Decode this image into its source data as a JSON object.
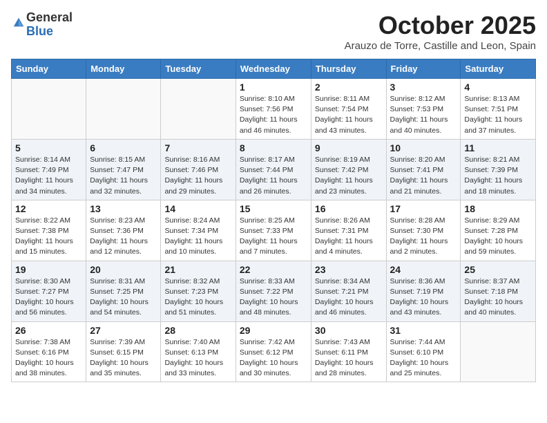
{
  "header": {
    "logo_general": "General",
    "logo_blue": "Blue",
    "month_title": "October 2025",
    "subtitle": "Arauzo de Torre, Castille and Leon, Spain"
  },
  "days_of_week": [
    "Sunday",
    "Monday",
    "Tuesday",
    "Wednesday",
    "Thursday",
    "Friday",
    "Saturday"
  ],
  "weeks": [
    [
      {
        "day": "",
        "sunrise": "",
        "sunset": "",
        "daylight": ""
      },
      {
        "day": "",
        "sunrise": "",
        "sunset": "",
        "daylight": ""
      },
      {
        "day": "",
        "sunrise": "",
        "sunset": "",
        "daylight": ""
      },
      {
        "day": "1",
        "sunrise": "Sunrise: 8:10 AM",
        "sunset": "Sunset: 7:56 PM",
        "daylight": "Daylight: 11 hours and 46 minutes."
      },
      {
        "day": "2",
        "sunrise": "Sunrise: 8:11 AM",
        "sunset": "Sunset: 7:54 PM",
        "daylight": "Daylight: 11 hours and 43 minutes."
      },
      {
        "day": "3",
        "sunrise": "Sunrise: 8:12 AM",
        "sunset": "Sunset: 7:53 PM",
        "daylight": "Daylight: 11 hours and 40 minutes."
      },
      {
        "day": "4",
        "sunrise": "Sunrise: 8:13 AM",
        "sunset": "Sunset: 7:51 PM",
        "daylight": "Daylight: 11 hours and 37 minutes."
      }
    ],
    [
      {
        "day": "5",
        "sunrise": "Sunrise: 8:14 AM",
        "sunset": "Sunset: 7:49 PM",
        "daylight": "Daylight: 11 hours and 34 minutes."
      },
      {
        "day": "6",
        "sunrise": "Sunrise: 8:15 AM",
        "sunset": "Sunset: 7:47 PM",
        "daylight": "Daylight: 11 hours and 32 minutes."
      },
      {
        "day": "7",
        "sunrise": "Sunrise: 8:16 AM",
        "sunset": "Sunset: 7:46 PM",
        "daylight": "Daylight: 11 hours and 29 minutes."
      },
      {
        "day": "8",
        "sunrise": "Sunrise: 8:17 AM",
        "sunset": "Sunset: 7:44 PM",
        "daylight": "Daylight: 11 hours and 26 minutes."
      },
      {
        "day": "9",
        "sunrise": "Sunrise: 8:19 AM",
        "sunset": "Sunset: 7:42 PM",
        "daylight": "Daylight: 11 hours and 23 minutes."
      },
      {
        "day": "10",
        "sunrise": "Sunrise: 8:20 AM",
        "sunset": "Sunset: 7:41 PM",
        "daylight": "Daylight: 11 hours and 21 minutes."
      },
      {
        "day": "11",
        "sunrise": "Sunrise: 8:21 AM",
        "sunset": "Sunset: 7:39 PM",
        "daylight": "Daylight: 11 hours and 18 minutes."
      }
    ],
    [
      {
        "day": "12",
        "sunrise": "Sunrise: 8:22 AM",
        "sunset": "Sunset: 7:38 PM",
        "daylight": "Daylight: 11 hours and 15 minutes."
      },
      {
        "day": "13",
        "sunrise": "Sunrise: 8:23 AM",
        "sunset": "Sunset: 7:36 PM",
        "daylight": "Daylight: 11 hours and 12 minutes."
      },
      {
        "day": "14",
        "sunrise": "Sunrise: 8:24 AM",
        "sunset": "Sunset: 7:34 PM",
        "daylight": "Daylight: 11 hours and 10 minutes."
      },
      {
        "day": "15",
        "sunrise": "Sunrise: 8:25 AM",
        "sunset": "Sunset: 7:33 PM",
        "daylight": "Daylight: 11 hours and 7 minutes."
      },
      {
        "day": "16",
        "sunrise": "Sunrise: 8:26 AM",
        "sunset": "Sunset: 7:31 PM",
        "daylight": "Daylight: 11 hours and 4 minutes."
      },
      {
        "day": "17",
        "sunrise": "Sunrise: 8:28 AM",
        "sunset": "Sunset: 7:30 PM",
        "daylight": "Daylight: 11 hours and 2 minutes."
      },
      {
        "day": "18",
        "sunrise": "Sunrise: 8:29 AM",
        "sunset": "Sunset: 7:28 PM",
        "daylight": "Daylight: 10 hours and 59 minutes."
      }
    ],
    [
      {
        "day": "19",
        "sunrise": "Sunrise: 8:30 AM",
        "sunset": "Sunset: 7:27 PM",
        "daylight": "Daylight: 10 hours and 56 minutes."
      },
      {
        "day": "20",
        "sunrise": "Sunrise: 8:31 AM",
        "sunset": "Sunset: 7:25 PM",
        "daylight": "Daylight: 10 hours and 54 minutes."
      },
      {
        "day": "21",
        "sunrise": "Sunrise: 8:32 AM",
        "sunset": "Sunset: 7:23 PM",
        "daylight": "Daylight: 10 hours and 51 minutes."
      },
      {
        "day": "22",
        "sunrise": "Sunrise: 8:33 AM",
        "sunset": "Sunset: 7:22 PM",
        "daylight": "Daylight: 10 hours and 48 minutes."
      },
      {
        "day": "23",
        "sunrise": "Sunrise: 8:34 AM",
        "sunset": "Sunset: 7:21 PM",
        "daylight": "Daylight: 10 hours and 46 minutes."
      },
      {
        "day": "24",
        "sunrise": "Sunrise: 8:36 AM",
        "sunset": "Sunset: 7:19 PM",
        "daylight": "Daylight: 10 hours and 43 minutes."
      },
      {
        "day": "25",
        "sunrise": "Sunrise: 8:37 AM",
        "sunset": "Sunset: 7:18 PM",
        "daylight": "Daylight: 10 hours and 40 minutes."
      }
    ],
    [
      {
        "day": "26",
        "sunrise": "Sunrise: 7:38 AM",
        "sunset": "Sunset: 6:16 PM",
        "daylight": "Daylight: 10 hours and 38 minutes."
      },
      {
        "day": "27",
        "sunrise": "Sunrise: 7:39 AM",
        "sunset": "Sunset: 6:15 PM",
        "daylight": "Daylight: 10 hours and 35 minutes."
      },
      {
        "day": "28",
        "sunrise": "Sunrise: 7:40 AM",
        "sunset": "Sunset: 6:13 PM",
        "daylight": "Daylight: 10 hours and 33 minutes."
      },
      {
        "day": "29",
        "sunrise": "Sunrise: 7:42 AM",
        "sunset": "Sunset: 6:12 PM",
        "daylight": "Daylight: 10 hours and 30 minutes."
      },
      {
        "day": "30",
        "sunrise": "Sunrise: 7:43 AM",
        "sunset": "Sunset: 6:11 PM",
        "daylight": "Daylight: 10 hours and 28 minutes."
      },
      {
        "day": "31",
        "sunrise": "Sunrise: 7:44 AM",
        "sunset": "Sunset: 6:10 PM",
        "daylight": "Daylight: 10 hours and 25 minutes."
      },
      {
        "day": "",
        "sunrise": "",
        "sunset": "",
        "daylight": ""
      }
    ]
  ]
}
